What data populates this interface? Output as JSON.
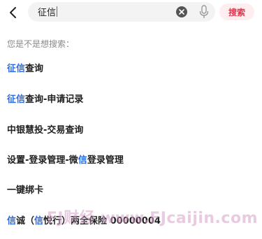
{
  "search": {
    "query": "征信",
    "button_label": "搜索"
  },
  "icons": {
    "back": "chevron-left-icon",
    "clear": "clear-circle-icon",
    "mic": "microphone-icon"
  },
  "colors": {
    "highlight": "#2b6be0",
    "search_button_text": "#e8304a",
    "search_button_bg": "#ffeef0",
    "watermark": "#d6a0c8"
  },
  "hint": "您是不是想搜索：",
  "suggestions": [
    {
      "parts": [
        {
          "t": "征信",
          "hl": true
        },
        {
          "t": "查询",
          "hl": false
        }
      ]
    },
    {
      "parts": [
        {
          "t": "征信",
          "hl": true
        },
        {
          "t": "查询-申请记录",
          "hl": false
        }
      ]
    },
    {
      "parts": [
        {
          "t": "中银慧投-交易查询",
          "hl": false
        }
      ]
    },
    {
      "parts": [
        {
          "t": "设置-登录管理-微",
          "hl": false
        },
        {
          "t": "信",
          "hl": true
        },
        {
          "t": "登录管理",
          "hl": false
        }
      ]
    },
    {
      "parts": [
        {
          "t": "一键绑卡",
          "hl": false
        }
      ]
    },
    {
      "parts": [
        {
          "t": "信",
          "hl": true
        },
        {
          "t": "诚（",
          "hl": false
        },
        {
          "t": "信",
          "hl": true
        },
        {
          "t": "悦行）两全保险 00000004",
          "hl": false
        }
      ]
    }
  ],
  "watermark": "FJ财经 www.FJcaijin.com"
}
